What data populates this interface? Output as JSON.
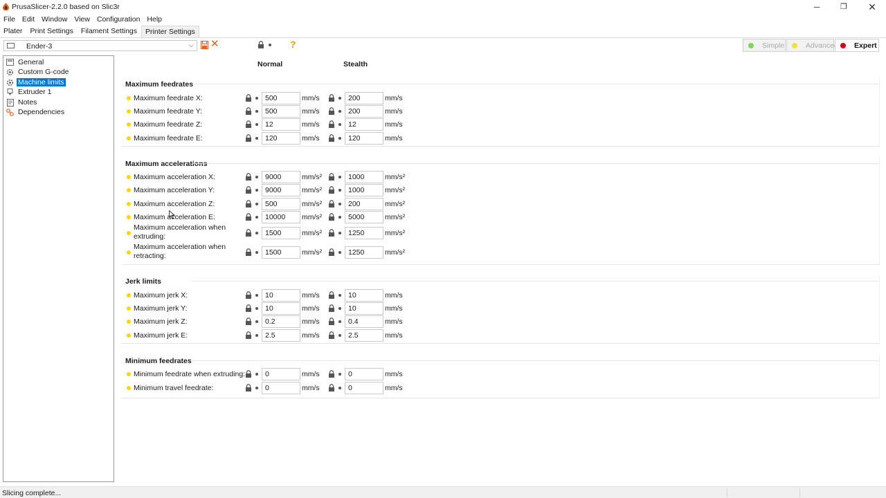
{
  "window": {
    "title": "PrusaSlicer-2.2.0 based on Slic3r",
    "min_glyph": "─",
    "max_glyph": "❐",
    "close_glyph": "✕"
  },
  "menu": [
    "File",
    "Edit",
    "Window",
    "View",
    "Configuration",
    "Help"
  ],
  "tabs": [
    "Plater",
    "Print Settings",
    "Filament Settings",
    "Printer Settings"
  ],
  "preset": {
    "value": "Ender-3",
    "arrow": "⌵"
  },
  "modes": {
    "simple": {
      "label": "Simple",
      "color": "#7ed957"
    },
    "advanced": {
      "label": "Advanced",
      "color": "#f5e03b"
    },
    "expert": {
      "label": "Expert",
      "color": "#d9001b"
    }
  },
  "toolbar": {
    "delete_glyph": "✕",
    "help_glyph": "?"
  },
  "sidebar": [
    {
      "label": "General",
      "icon": "printer-icon"
    },
    {
      "label": "Custom G-code",
      "icon": "gear-icon"
    },
    {
      "label": "Machine limits",
      "icon": "gear-icon"
    },
    {
      "label": "Extruder 1",
      "icon": "extruder-icon"
    },
    {
      "label": "Notes",
      "icon": "notes-icon"
    },
    {
      "label": "Dependencies",
      "icon": "dependencies-icon"
    }
  ],
  "columns": {
    "normal": "Normal",
    "stealth": "Stealth"
  },
  "groups": [
    {
      "title": "Maximum feedrates",
      "rows": [
        {
          "label": "Maximum feedrate X:",
          "normal": "500",
          "stealth": "200",
          "unit": "mm/s"
        },
        {
          "label": "Maximum feedrate Y:",
          "normal": "500",
          "stealth": "200",
          "unit": "mm/s"
        },
        {
          "label": "Maximum feedrate Z:",
          "normal": "12",
          "stealth": "12",
          "unit": "mm/s"
        },
        {
          "label": "Maximum feedrate E:",
          "normal": "120",
          "stealth": "120",
          "unit": "mm/s"
        }
      ]
    },
    {
      "title": "Maximum accelerations",
      "rows": [
        {
          "label": "Maximum acceleration X:",
          "normal": "9000",
          "stealth": "1000",
          "unit": "mm/s²"
        },
        {
          "label": "Maximum acceleration Y:",
          "normal": "9000",
          "stealth": "1000",
          "unit": "mm/s²"
        },
        {
          "label": "Maximum acceleration Z:",
          "normal": "500",
          "stealth": "200",
          "unit": "mm/s²"
        },
        {
          "label": "Maximum acceleration E:",
          "normal": "10000",
          "stealth": "5000",
          "unit": "mm/s²"
        },
        {
          "label": "Maximum acceleration when extruding:",
          "normal": "1500",
          "stealth": "1250",
          "unit": "mm/s²"
        },
        {
          "label": "Maximum acceleration when retracting:",
          "normal": "1500",
          "stealth": "1250",
          "unit": "mm/s²"
        }
      ]
    },
    {
      "title": "Jerk limits",
      "rows": [
        {
          "label": "Maximum jerk X:",
          "normal": "10",
          "stealth": "10",
          "unit": "mm/s"
        },
        {
          "label": "Maximum jerk Y:",
          "normal": "10",
          "stealth": "10",
          "unit": "mm/s"
        },
        {
          "label": "Maximum jerk Z:",
          "normal": "0.2",
          "stealth": "0.4",
          "unit": "mm/s"
        },
        {
          "label": "Maximum jerk E:",
          "normal": "2.5",
          "stealth": "2.5",
          "unit": "mm/s"
        }
      ]
    },
    {
      "title": "Minimum feedrates",
      "rows": [
        {
          "label": "Minimum feedrate when extruding:",
          "normal": "0",
          "stealth": "0",
          "unit": "mm/s"
        },
        {
          "label": "Minimum travel feedrate:",
          "normal": "0",
          "stealth": "0",
          "unit": "mm/s"
        }
      ]
    }
  ],
  "status": {
    "text": "Slicing complete..."
  }
}
